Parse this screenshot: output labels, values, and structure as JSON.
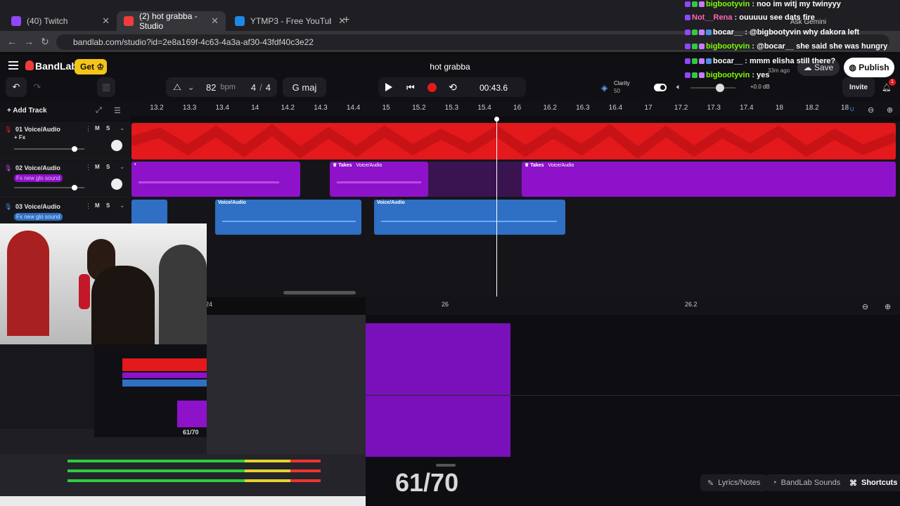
{
  "browser": {
    "tabs": [
      {
        "title": "(40) Twitch",
        "color": "#9146ff"
      },
      {
        "title": "(2) hot grabba - Studio",
        "color": "#f23b3b"
      },
      {
        "title": "YTMP3 - Free YouTube to MP3",
        "color": "#1e88e5"
      }
    ],
    "url": "bandlab.com/studio?id=2e8a169f-4c63-4a3a-af30-43fdf40c3e22",
    "ask_gemini": "Ask Gemini"
  },
  "app": {
    "brand": "BandLab",
    "get_label": "Get",
    "project_title": "hot grabba",
    "saved_ago": "33m ago",
    "save_label": "Save",
    "publish_label": "Publish",
    "invite_label": "Invite",
    "notif_count": "1"
  },
  "toolbar": {
    "bpm": "82",
    "bpm_unit": "bpm",
    "time_sig_num": "4",
    "time_sig_den": "4",
    "key": "G maj",
    "time": "00:43.6",
    "clarity_label": "Clarity",
    "clarity_value": "50",
    "volume_db": "+0.0 dB"
  },
  "add_track_label": "Add Track",
  "ruler_ticks": [
    "13.2",
    "13.3",
    "13.4",
    "14",
    "14.2",
    "14.3",
    "14.4",
    "15",
    "15.2",
    "15.3",
    "15.4",
    "16",
    "16.2",
    "16.3",
    "16.4",
    "17",
    "17.2",
    "17.3",
    "17.4",
    "18",
    "18.2",
    "18"
  ],
  "tracks": [
    {
      "name": "01  Voice/Audio",
      "fx": "+ Fx",
      "mute": "M",
      "solo": "S"
    },
    {
      "name": "02  Voice/Audio",
      "fx": "Fx new glo sound",
      "mute": "M",
      "solo": "S"
    },
    {
      "name": "03  Voice/Audio",
      "fx": "Fx new glo sound",
      "mute": "M",
      "solo": "S"
    }
  ],
  "clip_labels": {
    "takes": "Takes",
    "voice_audio": "Voice/Audio"
  },
  "lower_ruler": [
    "24",
    "26",
    "26.2"
  ],
  "counter": "61/70",
  "bottom_buttons": {
    "lyrics": "Lyrics/Notes",
    "sounds": "BandLab Sounds",
    "shortcuts": "Shortcuts"
  },
  "chat": [
    {
      "user": "bigbootyvin",
      "msg": "noo im witj my twinyyy",
      "color": "#7cfc00"
    },
    {
      "user": "Not__Rena",
      "msg": "ouuuuu see dats fire",
      "color": "#ff69b4"
    },
    {
      "user": "bocar__",
      "msg": "@bigbootyvin why dakora left",
      "color": "#ffffff"
    },
    {
      "user": "bigbootyvin",
      "msg": "@bocar__ she said she was hungry",
      "color": "#7cfc00"
    },
    {
      "user": "bocar__",
      "msg": "mmm elisha still there?",
      "color": "#ffffff"
    },
    {
      "user": "bigbootyvin",
      "msg": "yes",
      "color": "#7cfc00"
    }
  ],
  "colors": {
    "accent_red": "#f23b3b",
    "track1": "#e3191c",
    "track2": "#8e12c9",
    "track3": "#2f6fc4",
    "get_yellow": "#f5c518"
  }
}
